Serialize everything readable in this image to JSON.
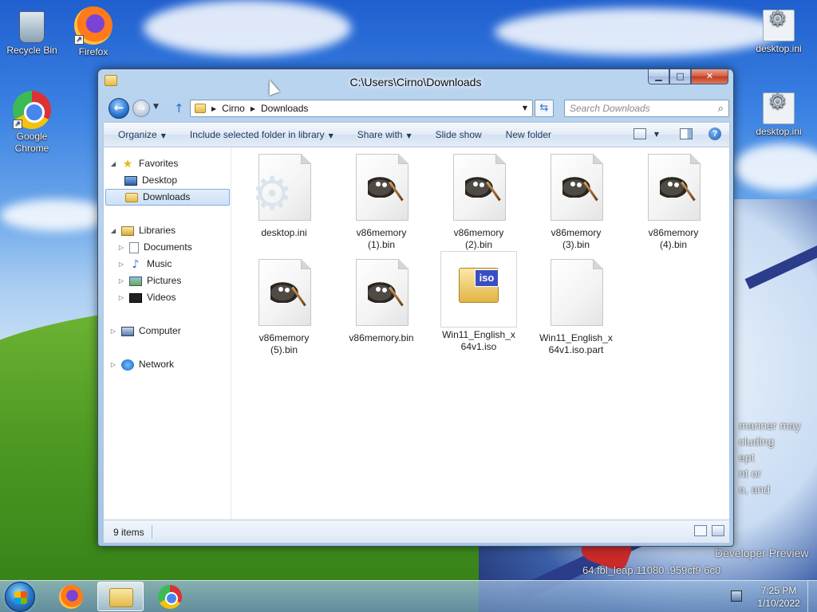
{
  "desktop": {
    "icons": [
      {
        "label": "Recycle Bin",
        "icon": "recycle-bin-icon"
      },
      {
        "label": "Firefox",
        "icon": "firefox-icon"
      },
      {
        "label": "Google Chrome",
        "icon": "chrome-icon"
      },
      {
        "label": "desktop.ini",
        "icon": "settings-file-icon"
      },
      {
        "label": "desktop.ini",
        "icon": "settings-file-icon"
      }
    ],
    "overlay_lines": [
      "manner may",
      "cluding",
      "ept",
      "nt or",
      "o, and",
      "Developer Preview",
      "64.fbl_leap.11080 .959cf9 6c0"
    ]
  },
  "window": {
    "title": "C:\\Users\\Cirno\\Downloads",
    "address": {
      "crumbs": [
        "Cirno",
        "Downloads"
      ]
    },
    "search": {
      "placeholder": "Search Downloads"
    },
    "commands": [
      "Organize",
      "Include selected folder in library",
      "Share with",
      "Slide show",
      "New folder"
    ],
    "nav": {
      "favorites": {
        "label": "Favorites",
        "items": [
          "Desktop",
          "Downloads"
        ],
        "selected": "Downloads"
      },
      "libraries": {
        "label": "Libraries",
        "items": [
          "Documents",
          "Music",
          "Pictures",
          "Videos"
        ]
      },
      "computer": {
        "label": "Computer"
      },
      "network": {
        "label": "Network"
      }
    },
    "files": [
      {
        "name": "desktop.ini",
        "type": "settings-file-icon"
      },
      {
        "name": "v86memory (1).bin",
        "type": "gimp-file-icon"
      },
      {
        "name": "v86memory (2).bin",
        "type": "gimp-file-icon"
      },
      {
        "name": "v86memory (3).bin",
        "type": "gimp-file-icon"
      },
      {
        "name": "v86memory (4).bin",
        "type": "gimp-file-icon"
      },
      {
        "name": "v86memory (5).bin",
        "type": "gimp-file-icon"
      },
      {
        "name": "v86memory.bin",
        "type": "gimp-file-icon"
      },
      {
        "name": "Win11_English_x64v1.iso",
        "type": "iso-file-icon",
        "label": "iso",
        "selected": true
      },
      {
        "name": "Win11_English_x64v1.iso.part",
        "type": "blank-file-icon"
      }
    ],
    "status": {
      "item_count": "9 items"
    }
  },
  "taskbar": {
    "pinned": [
      "firefox-icon",
      "explorer-icon",
      "chrome-icon"
    ],
    "active": "explorer-icon",
    "clock": {
      "time": "7:25 PM",
      "date": "1/10/2022"
    }
  }
}
